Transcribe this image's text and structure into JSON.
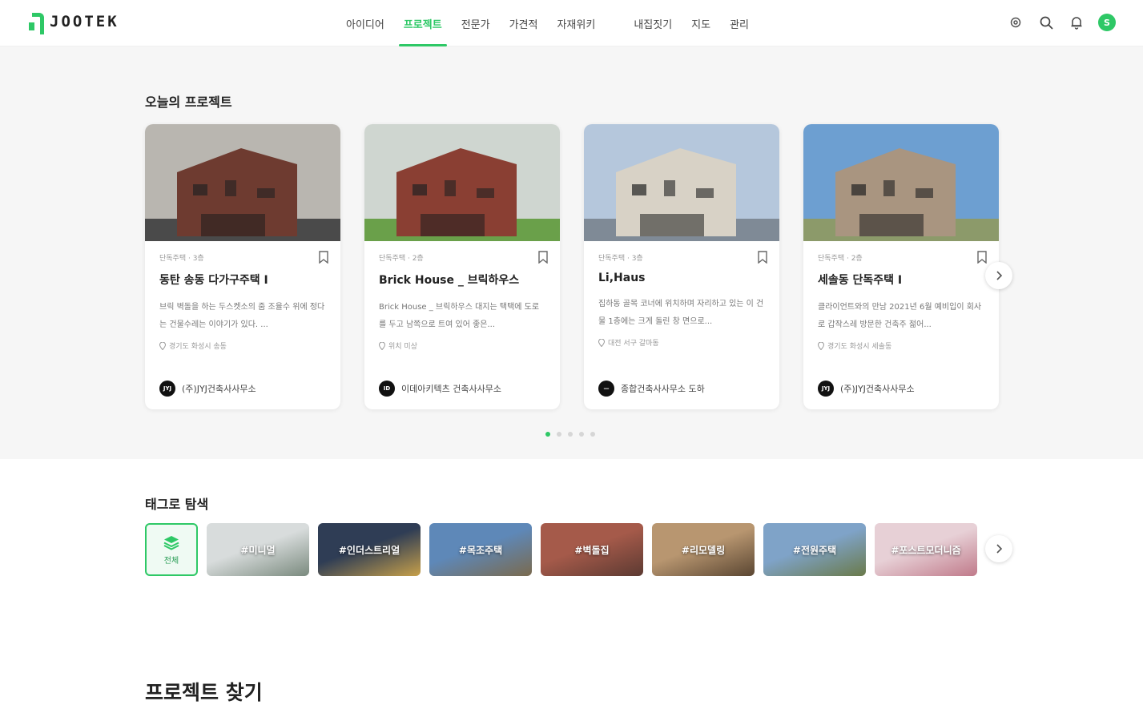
{
  "brand": {
    "name": "JOOTEK"
  },
  "nav": {
    "items": [
      "아이디어",
      "프로젝트",
      "전문가",
      "가견적",
      "자재위키"
    ],
    "items2": [
      "내집짓기",
      "지도",
      "관리"
    ],
    "active": "프로젝트"
  },
  "user": {
    "avatar_initial": "S"
  },
  "today": {
    "title": "오늘의 프로젝트",
    "cards": [
      {
        "meta": "단독주택 · 3층",
        "title": "동탄 송동 다가구주택 I",
        "desc": "브릭 벽돌을 하는 두스켓소의 줌 조율수 위에 정다는 건물수레는 이야기가 있다. ...",
        "location": "경기도 화성시 송동",
        "office": "(주)JYJ건축사사무소",
        "office_logo": "JYJ",
        "colors": [
          "#b9b6b0",
          "#6e3b30",
          "#4a4a4a"
        ]
      },
      {
        "meta": "단독주택 · 2층",
        "title": "Brick House _ 브릭하우스",
        "desc": "Brick House _ 브릭하우스 대지는 택택에 도로를 두고 남쪽으로 트여 있어 좋은...",
        "location": "위치 미상",
        "office": "이데아키텍츠 건축사사무소",
        "office_logo": "ID",
        "colors": [
          "#cfd6d0",
          "#8a3f33",
          "#6aa04a"
        ]
      },
      {
        "meta": "단독주택 · 3층",
        "title": "Li,Haus",
        "desc": "집하동 골목 코너에 위치하며 자리하고 있는 이 건물 1층에는 크게 돌린 창 면으로...",
        "location": "대전 서구 갈마동",
        "office": "종합건축사사무소 도하",
        "office_logo": "—",
        "colors": [
          "#b5c7dc",
          "#d8d2c6",
          "#7f8a96"
        ]
      },
      {
        "meta": "단독주택 · 2층",
        "title": "세솔동 단독주택 I",
        "desc": "클라이언트와의 만남 2021년 6월 예비입이 회사로 갑작스레 방문한 건축주 젊어...",
        "location": "경기도 화성시 세솔동",
        "office": "(주)JYJ건축사사무소",
        "office_logo": "JYJ",
        "colors": [
          "#6d9fd1",
          "#a99580",
          "#8c9a6a"
        ]
      }
    ],
    "dots": 5,
    "active_dot": 0
  },
  "tags": {
    "title": "태그로 탐색",
    "all_label": "전체",
    "items": [
      {
        "label": "#미니멀",
        "colors": [
          "#d8dcdc",
          "#7a8a7e"
        ]
      },
      {
        "label": "#인더스트리얼",
        "colors": [
          "#2f3d55",
          "#c7a04a"
        ]
      },
      {
        "label": "#목조주택",
        "colors": [
          "#5e88b8",
          "#7a6a4e"
        ]
      },
      {
        "label": "#벽돌집",
        "colors": [
          "#a55a4a",
          "#5c3a32"
        ]
      },
      {
        "label": "#리모델링",
        "colors": [
          "#b89670",
          "#5a4632"
        ]
      },
      {
        "label": "#전원주택",
        "colors": [
          "#7fa3c8",
          "#6a7a4a"
        ]
      },
      {
        "label": "#포스트모더니즘",
        "colors": [
          "#e7d0d6",
          "#c07a8a"
        ]
      }
    ]
  },
  "find": {
    "title": "프로젝트 찾기"
  },
  "colors": {
    "accent": "#2ec866"
  }
}
